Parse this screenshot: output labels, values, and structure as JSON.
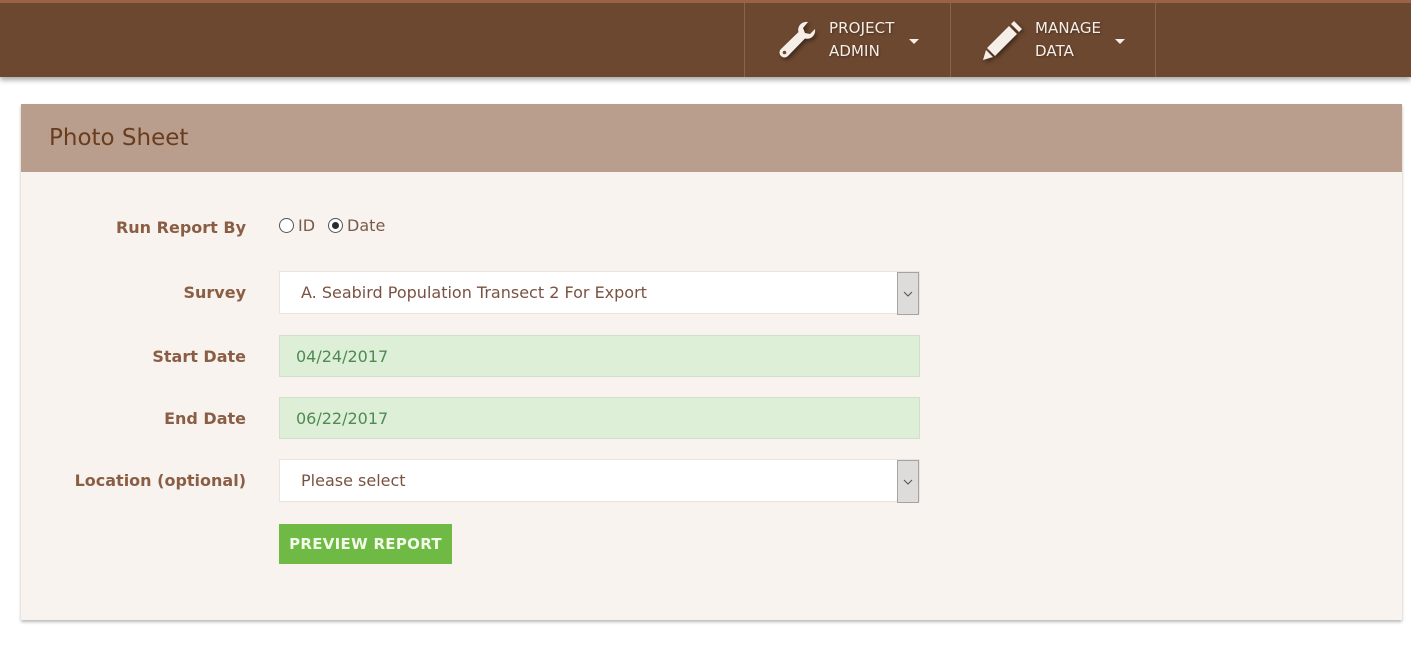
{
  "nav": {
    "items": [
      {
        "icon": "wrench-icon",
        "line1": "PROJECT",
        "line2": "ADMIN"
      },
      {
        "icon": "pencil-icon",
        "line1": "MANAGE",
        "line2": "DATA"
      }
    ]
  },
  "panel": {
    "title": "Photo Sheet"
  },
  "form": {
    "run_report_by": {
      "label": "Run Report By",
      "options": [
        {
          "label": "ID",
          "checked": false
        },
        {
          "label": "Date",
          "checked": true
        }
      ]
    },
    "survey": {
      "label": "Survey",
      "value": "A. Seabird Population Transect 2 For Export"
    },
    "start_date": {
      "label": "Start Date",
      "value": "04/24/2017"
    },
    "end_date": {
      "label": "End Date",
      "value": "06/22/2017"
    },
    "location": {
      "label": "Location (optional)",
      "value": "Please select"
    },
    "preview_button": "PREVIEW REPORT"
  },
  "colors": {
    "nav_bg": "#6d4830",
    "panel_header_bg": "#b99e8d",
    "panel_bg": "#f8f3ef",
    "title_text": "#6a3c1e",
    "date_field_bg": "#ddefd7",
    "primary_button": "#6fb945"
  }
}
